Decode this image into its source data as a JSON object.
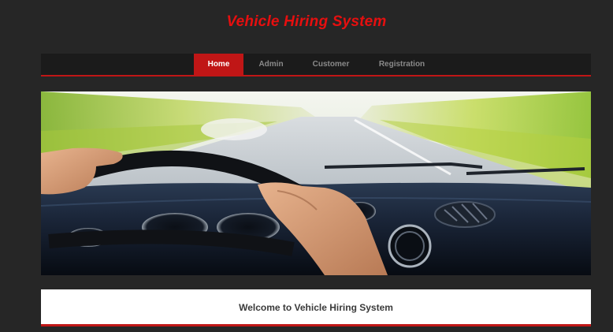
{
  "site": {
    "title": "Vehicle Hiring System",
    "accent_color": "#c01616",
    "title_color": "#e60f0f"
  },
  "nav": {
    "items": [
      {
        "label": "Home",
        "active": true
      },
      {
        "label": "Admin",
        "active": false
      },
      {
        "label": "Customer",
        "active": false
      },
      {
        "label": "Registration",
        "active": false
      }
    ]
  },
  "banner": {
    "icon": "driving-scene-image"
  },
  "welcome": {
    "text": "Welcome to Vehicle Hiring System"
  }
}
